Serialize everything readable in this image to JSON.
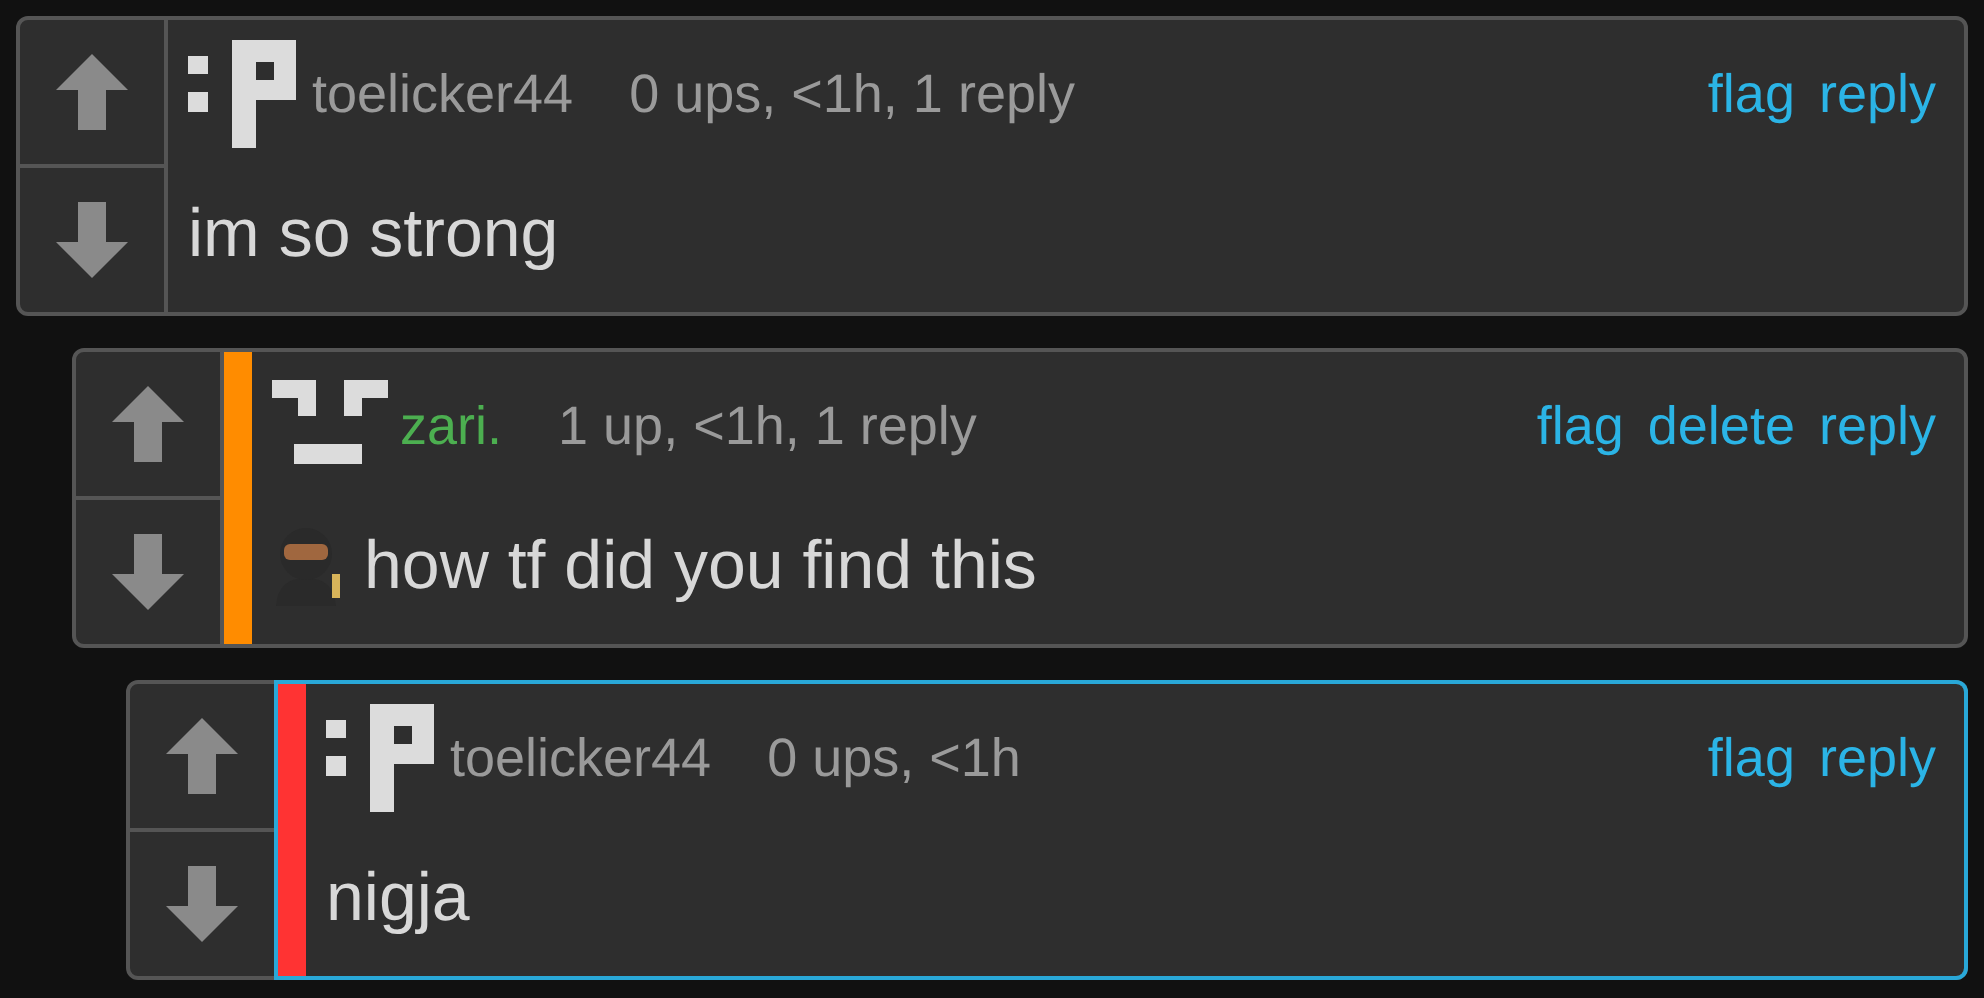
{
  "comments": [
    {
      "avatar": {
        "kind": "blocks_p"
      },
      "author": {
        "name": "toelicker44",
        "color": "#9a9a9a"
      },
      "meta": "0 ups, <1h, 1 reply",
      "actions": [
        "flag",
        "reply"
      ],
      "highlighted": false,
      "body": "im so strong",
      "emoji": false
    },
    {
      "avatar": {
        "kind": "blocks_face"
      },
      "author": {
        "name": "zari.",
        "color": "#4caf50"
      },
      "meta": "1 up, <1h, 1 reply",
      "actions": [
        "flag",
        "delete",
        "reply"
      ],
      "accent": {
        "color": "#ff8c00"
      },
      "highlighted": false,
      "body": "how tf did you find this",
      "emoji": true
    },
    {
      "avatar": {
        "kind": "blocks_p"
      },
      "author": {
        "name": "toelicker44",
        "color": "#9a9a9a"
      },
      "meta": "0 ups, <1h",
      "actions": [
        "flag",
        "reply"
      ],
      "accent": {
        "color": "#ff3333"
      },
      "highlighted": true,
      "body": "nigja",
      "emoji": false
    }
  ]
}
